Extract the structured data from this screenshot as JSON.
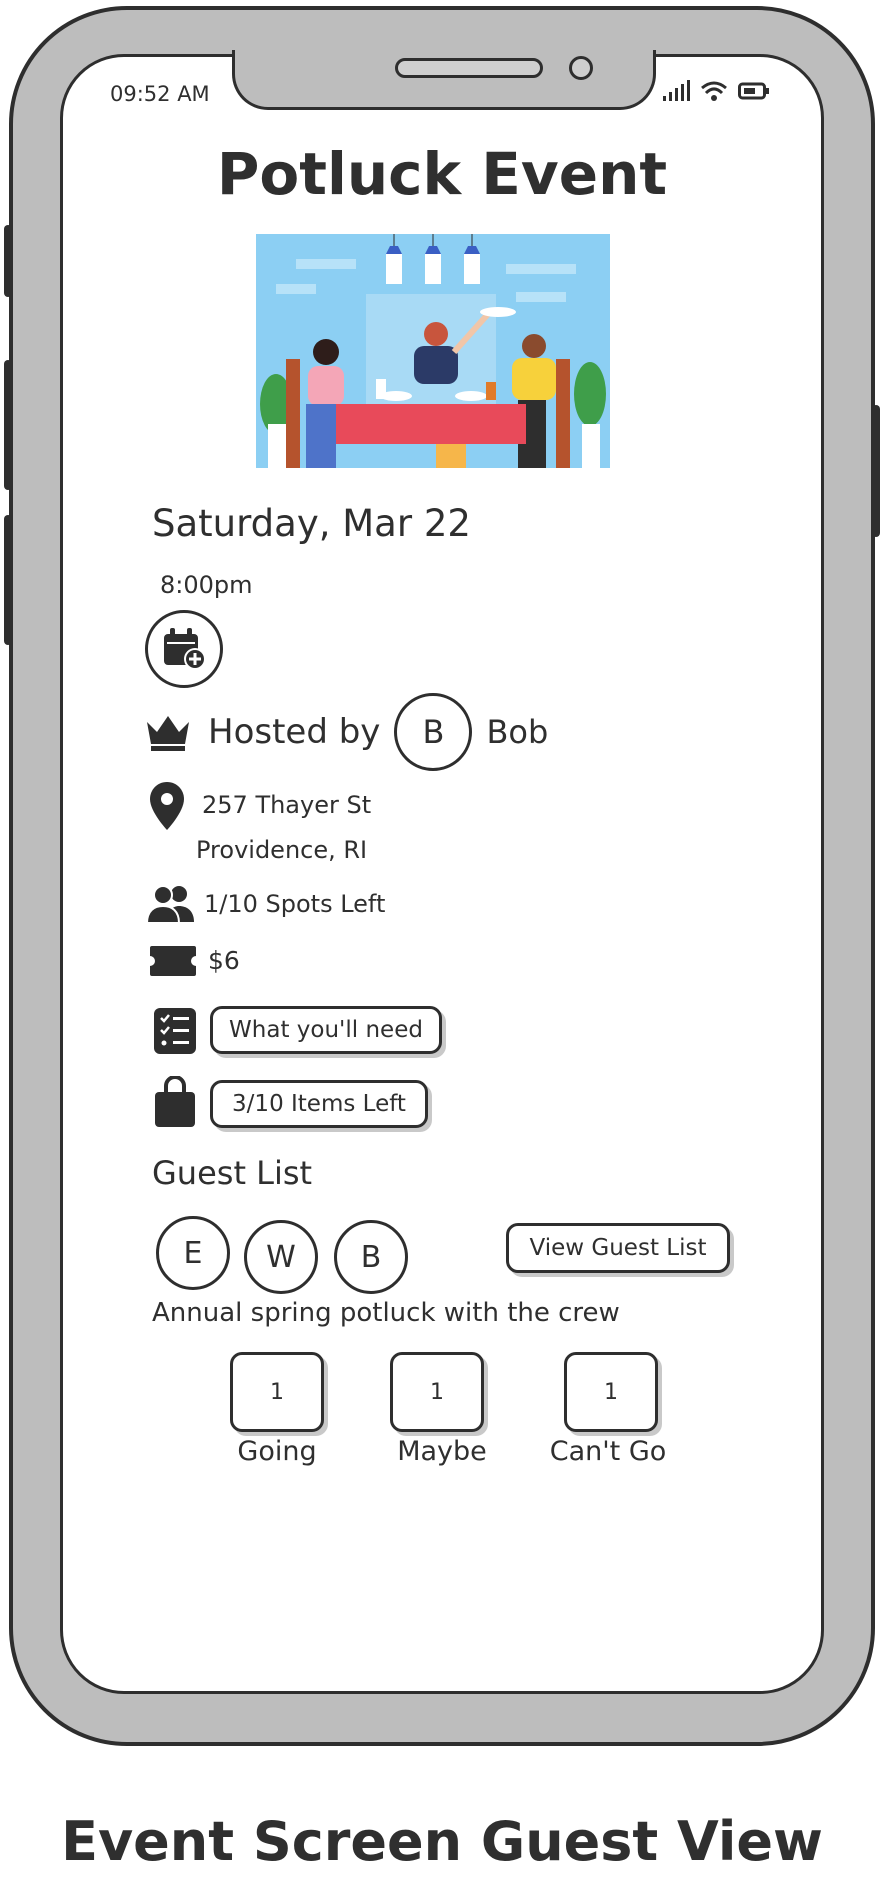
{
  "status_bar": {
    "time": "09:52 AM"
  },
  "event": {
    "title": "Potluck Event",
    "date": "Saturday, Mar 22",
    "time": "8:00pm",
    "hosted_by_label": "Hosted by",
    "host_initial": "B",
    "host_name": "Bob",
    "address_line1": "257 Thayer St",
    "address_line2": "Providence, RI",
    "spots": "1/10 Spots Left",
    "price": "$6",
    "need_button": "What you'll need",
    "items_button": "3/10 Items Left",
    "description": "Annual spring potluck with the crew"
  },
  "guest_list": {
    "title": "Guest List",
    "guests": [
      "E",
      "W",
      "B"
    ],
    "view_button": "View Guest List"
  },
  "rsvp": [
    {
      "count": "1",
      "label": "Going"
    },
    {
      "count": "1",
      "label": "Maybe"
    },
    {
      "count": "1",
      "label": "Can't Go"
    }
  ],
  "caption": "Event Screen Guest View",
  "icons": [
    "signal-icon",
    "wifi-icon",
    "battery-icon",
    "calendar-add-icon",
    "crown-icon",
    "location-pin-icon",
    "people-icon",
    "ticket-icon",
    "checklist-icon",
    "shopping-bag-icon"
  ],
  "colors": {
    "outline": "#2e2e2e",
    "frame": "#bdbdbd",
    "text": "#2f2f2f",
    "hero_bg": "#8ccff3"
  }
}
